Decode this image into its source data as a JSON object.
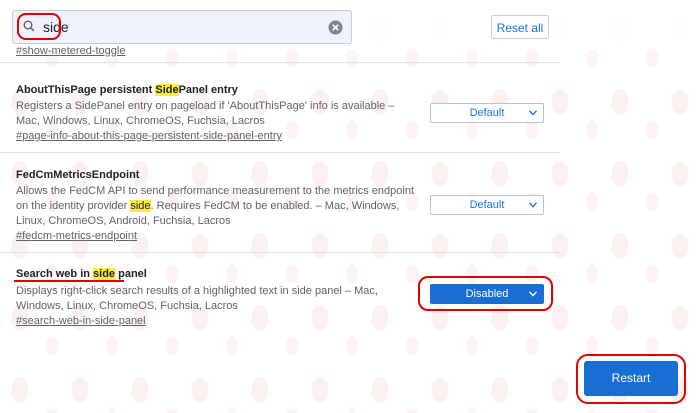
{
  "search": {
    "value": "side"
  },
  "reset_label": "Reset all",
  "prev_anchor": "#show-metered-toggle",
  "flags": [
    {
      "title_pre": "AboutThisPage persistent ",
      "title_mark": "Side",
      "title_post": "Panel entry",
      "desc_pre": "Registers a SidePanel entry on pageload if 'AboutThisPage' info is available – Mac, Windows, Linux, ChromeOS, Fuchsia, Lacros",
      "anchor": "#page-info-about-this-page-persistent-side-panel-entry",
      "select_value": "Default"
    },
    {
      "title": "FedCmMetricsEndpoint",
      "desc_pre": "Allows the FedCM API to send performance measurement to the metrics endpoint on the identity provider ",
      "desc_mark": "side",
      "desc_post": ". Requires FedCM to be enabled. – Mac, Windows, Linux, ChromeOS, Android, Fuchsia, Lacros",
      "anchor": "#fedcm-metrics-endpoint",
      "select_value": "Default"
    },
    {
      "title_pre": "Search web in ",
      "title_mark": "side",
      "title_post": " panel",
      "desc_pre": "Displays right-click search results of a highlighted text in side panel – Mac, Windows, Linux, ChromeOS, Fuchsia, Lacros",
      "anchor": "#search-web-in-side-panel",
      "select_value": "Disabled"
    }
  ],
  "restart_label": "Restart",
  "colors": {
    "accent": "#1a6fd6",
    "highlight": "#ffeb3b",
    "annotation": "#e00000"
  },
  "icons": {
    "search": "search-icon",
    "clear": "clear-icon",
    "chevron": "chevron-down-icon"
  }
}
